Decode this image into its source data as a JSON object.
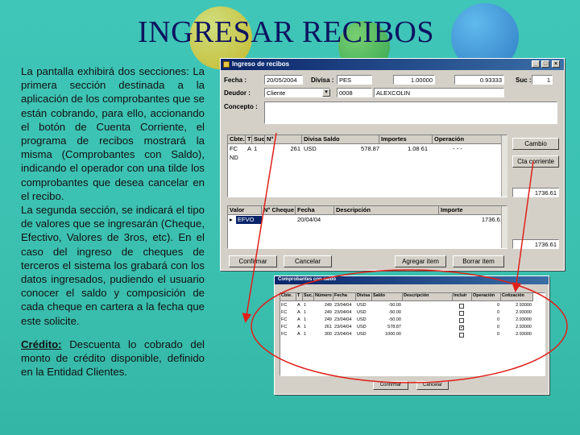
{
  "slide": {
    "title": "INGRESAR RECIBOS",
    "paragraphs": [
      "La pantalla exhibirá dos secciones: La primera sección destinada a la aplicación de los comprobantes que se están cobrando, para ello, accionando el botón de Cuenta Corriente, el programa de recibos mostrará la misma (Comprobantes con Saldo), indicando el operador con una tilde los comprobantes que desea cancelar en el recibo.",
      "La segunda sección, se indicará el tipo de valores que se ingresarán (Cheque, Efectivo, Valores de 3ros, etc). En el caso del ingreso de cheques de terceros el sistema los grabará con los datos ingresados, pudiendo el usuario conocer el saldo y composición de cada cheque en cartera a la fecha que este solicite."
    ],
    "credit_title": "Crédito:",
    "credit_text": " Descuenta lo cobrado del monto de crédito disponible, definido en la Entidad Clientes."
  },
  "main_window": {
    "title": "Ingreso de recibos",
    "labels": {
      "fecha": "Fecha :",
      "divisa": "Divisa :",
      "suc": "Suc :",
      "deudor": "Deudor :",
      "concepto": "Concepto :"
    },
    "values": {
      "fecha": "20/05/2004",
      "divisa": "PES",
      "rate1": "1.00000",
      "rate2": "0.93333",
      "suc": "1",
      "deudor": "Cliente",
      "code": "0008",
      "name": "ALEXCOLIN"
    },
    "grid1": {
      "headers": [
        "Cbte.",
        "T",
        "Suc.",
        "N°",
        "Divisa Saldo",
        "Importes",
        "Operación"
      ],
      "rows": [
        [
          "FC",
          "A",
          "1",
          "261",
          "USD",
          "578.87",
          "1.08 61",
          "- - -"
        ],
        [
          "ND",
          "",
          "",
          "",
          "",
          "",
          "",
          ""
        ]
      ]
    },
    "grid2": {
      "headers": [
        "Valor",
        "N° Cheque",
        "Fecha",
        "Descripción",
        "Importe"
      ],
      "rows": [
        [
          "EFVO",
          "",
          "20/04/04",
          "",
          "1736.61"
        ]
      ]
    },
    "side_buttons": [
      "Cambio",
      "Cta corriente"
    ],
    "totals": [
      "1736.61",
      "1736.61"
    ],
    "bottom_buttons": [
      "Confirmar",
      "Cancelar",
      "Agregar item",
      "Borrar item"
    ]
  },
  "saldo_window": {
    "title": "Comprobantes con saldo",
    "headers": [
      "Cbte.",
      "T",
      "Suc.",
      "Número",
      "Fecha",
      "Divisa",
      "Saldo",
      "Descripción",
      "Incluir",
      "Operación",
      "Cotización"
    ],
    "rows": [
      [
        "FC",
        "A",
        "1",
        "249",
        "23/04/04",
        "USD",
        "-50.00",
        "",
        false,
        "0",
        "2.93000"
      ],
      [
        "FC",
        "A",
        "1",
        "249",
        "23/04/04",
        "USD",
        "-50.00",
        "",
        false,
        "0",
        "2.93000"
      ],
      [
        "FC",
        "A",
        "1",
        "249",
        "23/04/04",
        "USD",
        "-50.00",
        "",
        false,
        "0",
        "2.93000"
      ],
      [
        "FC",
        "A",
        "1",
        "261",
        "23/04/04",
        "USD",
        "578.87",
        "",
        true,
        "0",
        "2.93000"
      ],
      [
        "FC",
        "A",
        "1",
        "300",
        "23/04/04",
        "USD",
        "1000.00",
        "",
        false,
        "0",
        "2.93000"
      ]
    ],
    "buttons": [
      "Confirmar",
      "Cancelar"
    ]
  },
  "colors": {
    "background": "#3fc6b8",
    "title": "#0d1460",
    "titlebar": "#0a246a",
    "annotation": "#e0201a"
  }
}
